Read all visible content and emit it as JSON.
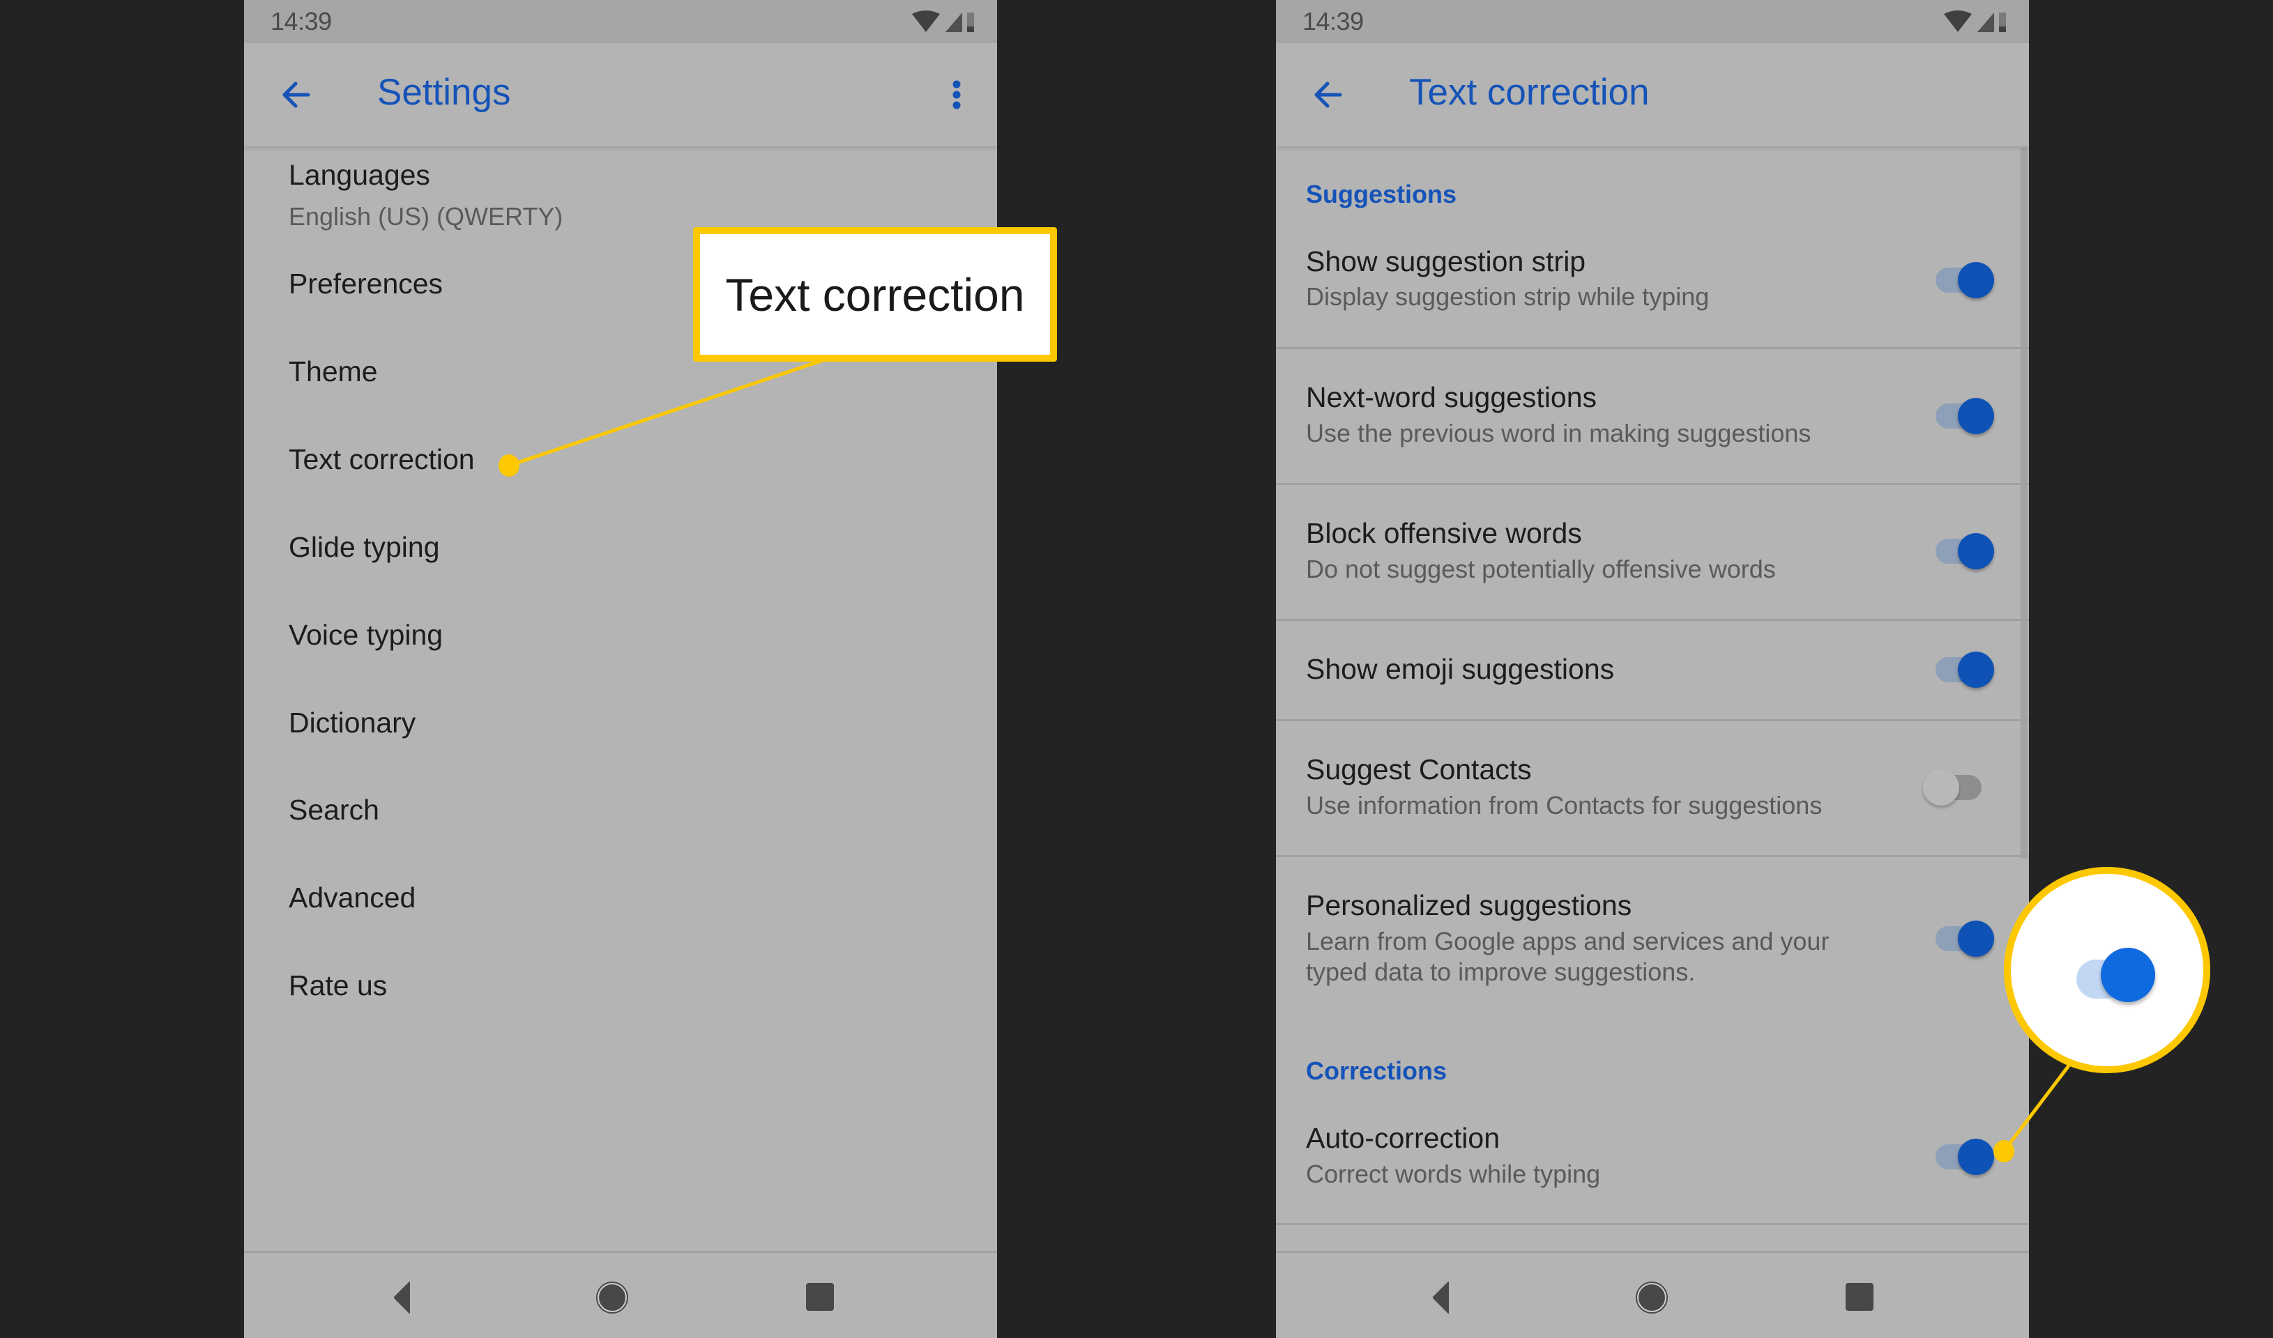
{
  "left_phone": {
    "status_time": "14:39",
    "title": "Settings",
    "items": [
      {
        "title": "Languages",
        "subtitle": "English (US) (QWERTY)"
      },
      {
        "title": "Preferences"
      },
      {
        "title": "Theme"
      },
      {
        "title": "Text correction"
      },
      {
        "title": "Glide typing"
      },
      {
        "title": "Voice typing"
      },
      {
        "title": "Dictionary"
      },
      {
        "title": "Search"
      },
      {
        "title": "Advanced"
      },
      {
        "title": "Rate us"
      }
    ],
    "callout_label": "Text correction"
  },
  "right_phone": {
    "status_time": "14:39",
    "title": "Text correction",
    "sections": [
      {
        "header": "Suggestions",
        "items": [
          {
            "title": "Show suggestion strip",
            "subtitle": "Display suggestion strip while typing",
            "enabled": true
          },
          {
            "title": "Next-word suggestions",
            "subtitle": "Use the previous word in making suggestions",
            "enabled": true
          },
          {
            "title": "Block offensive words",
            "subtitle": "Do not suggest potentially offensive words",
            "enabled": true
          },
          {
            "title": "Show emoji suggestions",
            "enabled": true
          },
          {
            "title": "Suggest Contacts",
            "subtitle": "Use information from Contacts for suggestions",
            "enabled": false
          },
          {
            "title": "Personalized suggestions",
            "subtitle_line1": "Learn from Google apps and services and your",
            "subtitle_line2": "typed data to improve suggestions.",
            "enabled": true
          }
        ]
      },
      {
        "header": "Corrections",
        "items": [
          {
            "title": "Auto-correction",
            "subtitle": "Correct words while typing",
            "enabled": true
          }
        ]
      }
    ],
    "callout_toggle_enabled": true
  },
  "icons": {
    "back": "arrow-left-icon",
    "more": "more-vert-icon",
    "wifi": "wifi-icon",
    "signal": "signal-icon",
    "battery": "battery-icon",
    "nav_back": "nav-back-icon",
    "nav_home": "nav-home-icon",
    "nav_recents": "nav-recents-icon"
  },
  "colors": {
    "accent": "#1553b8",
    "highlight": "#fdc800",
    "toggle_on": "#0f52b5",
    "background": "#232323",
    "screen": "#b4b4b4"
  }
}
